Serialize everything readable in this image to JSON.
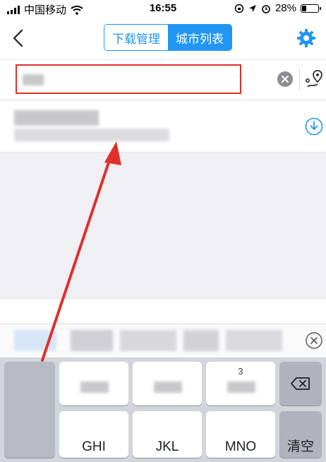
{
  "status_bar": {
    "carrier": "中国移动",
    "time": "16:55",
    "battery": "28%",
    "battery_level": 0.28
  },
  "nav": {
    "tab_download": "下载管理",
    "tab_city_list": "城市列表",
    "active_tab": "城市列表"
  },
  "keyboard": {
    "keys": {
      "row3_ghi": "GHI",
      "row3_jkl": "JKL",
      "row3_mno": "MNO",
      "row2_num": "3",
      "clear": "清空"
    }
  },
  "colors": {
    "accent": "#2196f3",
    "annotation": "#e0302a"
  },
  "icons": {
    "back": "chevron-left-icon",
    "settings": "gear-icon",
    "clear": "clear-circle-icon",
    "route": "route-pin-icon",
    "download": "download-circle-icon",
    "backspace": "backspace-icon",
    "candidate_close": "close-circle-icon"
  }
}
